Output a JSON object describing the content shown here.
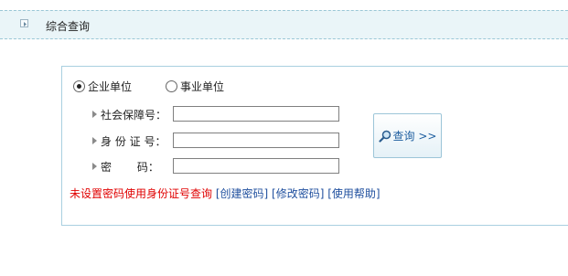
{
  "header": {
    "title": "综合查询"
  },
  "org_type": {
    "options": [
      "企业单位",
      "事业单位"
    ],
    "selected": "企业单位"
  },
  "fields": {
    "social_security": {
      "label": "社会保障号：",
      "value": ""
    },
    "id_number": {
      "label": "身 份 证 号：",
      "value": ""
    },
    "password": {
      "label": "密　　 码：",
      "value": ""
    }
  },
  "query_button": {
    "label": "查询 >>"
  },
  "hints": {
    "warning": "未设置密码使用身份证号查询",
    "create_password": "[创建密码]",
    "change_password": "[修改密码]",
    "help": "[使用帮助]"
  }
}
